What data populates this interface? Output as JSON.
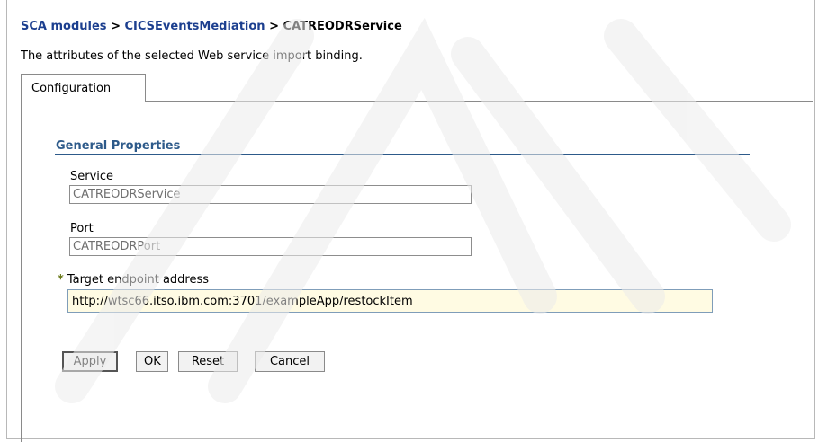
{
  "breadcrumb": {
    "level1": "SCA modules",
    "level2": "CICSEventsMediation",
    "separator": ">",
    "current": "CATREODRService"
  },
  "description": "The attributes of the selected Web service import binding.",
  "tabs": [
    {
      "label": "Configuration"
    }
  ],
  "general_properties": {
    "title": "General Properties",
    "service": {
      "label": "Service",
      "value": "CATREODRService"
    },
    "port": {
      "label": "Port",
      "value": "CATREODRPort"
    },
    "endpoint": {
      "required_marker": "*",
      "label": "Target endpoint address",
      "value": "http://wtsc66.itso.ibm.com:3701/exampleApp/restockItem"
    }
  },
  "buttons": {
    "apply": "Apply",
    "ok": "OK",
    "reset": "Reset",
    "cancel": "Cancel"
  },
  "colors": {
    "link": "#1c3f8f",
    "section_title": "#2d5a8a",
    "required_marker": "#6a7a1a",
    "editable_field_bg": "#fffbe3"
  }
}
